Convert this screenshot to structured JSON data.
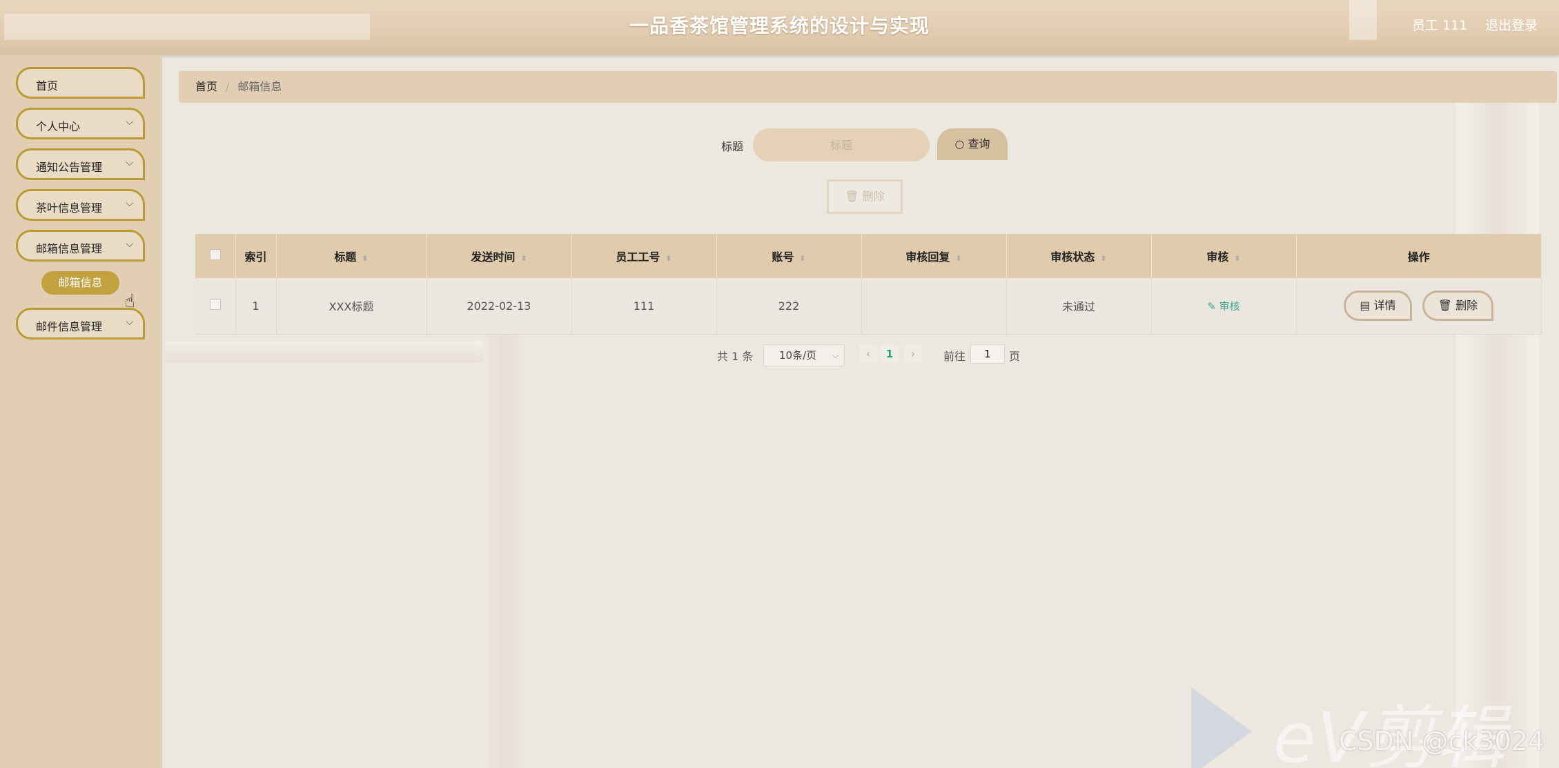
{
  "header": {
    "title": "一品香茶馆管理系统的设计与实现",
    "user": "员工 111",
    "logout": "退出登录"
  },
  "sidebar": {
    "items": [
      {
        "label": "首页"
      },
      {
        "label": "个人中心"
      },
      {
        "label": "通知公告管理"
      },
      {
        "label": "茶叶信息管理"
      },
      {
        "label": "邮箱信息管理"
      },
      {
        "label": "邮件信息管理"
      }
    ],
    "submenu_active": "邮箱信息"
  },
  "breadcrumb": {
    "home": "首页",
    "separator": "/",
    "current": "邮箱信息"
  },
  "search": {
    "label": "标题",
    "placeholder": "标题",
    "query_button": "查询"
  },
  "toolbar": {
    "delete_button": "删除"
  },
  "table": {
    "headers": [
      "索引",
      "标题",
      "发送时间",
      "员工工号",
      "账号",
      "审核回复",
      "审核状态",
      "审核",
      "操作"
    ],
    "rows": [
      {
        "index": "1",
        "title": "XXX标题",
        "send_time": "2022-02-13",
        "employee_id": "111",
        "account": "222",
        "review_reply": "",
        "review_status": "未通过",
        "review_action": "审核",
        "detail_button": "详情",
        "delete_button": "删除"
      }
    ]
  },
  "pagination": {
    "total": "共 1 条",
    "page_size": "10条/页",
    "current_page": "1",
    "goto_label": "前往",
    "goto_value": "1",
    "page_unit": "页"
  },
  "watermark": {
    "brand": "eV剪辑",
    "csdn": "CSDN @ck3024"
  }
}
